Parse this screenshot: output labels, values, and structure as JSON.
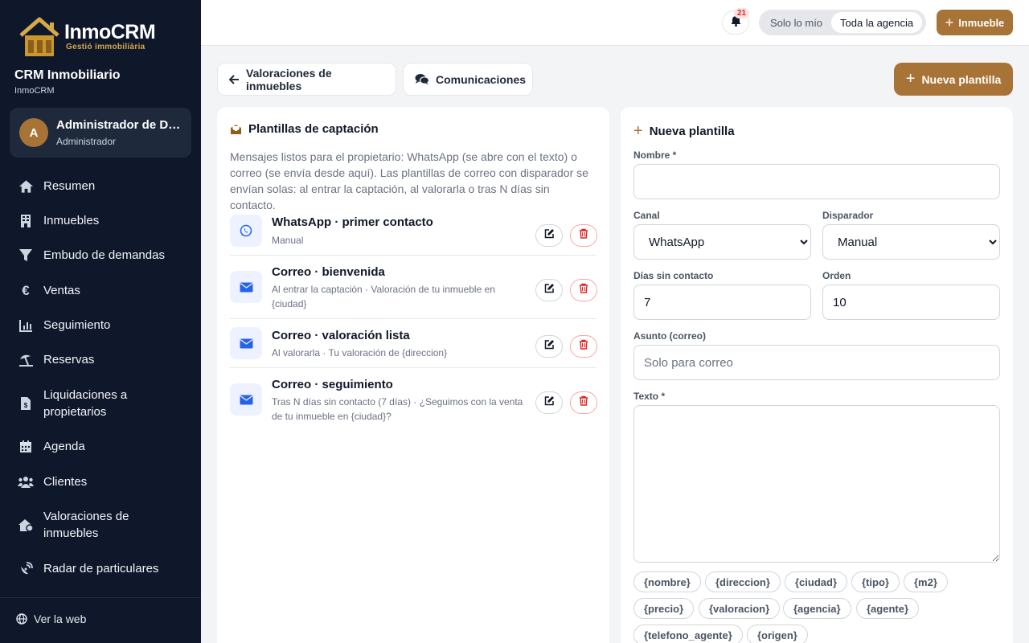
{
  "brand": {
    "name": "InmoCRM",
    "tagline": "Gestió immobiliària",
    "crm_title": "CRM Inmobiliario",
    "crm_subtitle": "InmoCRM"
  },
  "user": {
    "initial": "A",
    "name": "Administrador de De...",
    "role": "Administrador"
  },
  "sidebar": {
    "items": [
      {
        "label": "Resumen",
        "icon": "home-icon"
      },
      {
        "label": "Inmuebles",
        "icon": "building-icon"
      },
      {
        "label": "Embudo de demandas",
        "icon": "funnel-icon"
      },
      {
        "label": "Ventas",
        "icon": "euro-icon"
      },
      {
        "label": "Seguimiento",
        "icon": "bar-chart-icon"
      },
      {
        "label": "Reservas",
        "icon": "umbrella-beach-icon"
      },
      {
        "label": "Liquidaciones a propietarios",
        "icon": "invoice-icon"
      },
      {
        "label": "Agenda",
        "icon": "calendar-icon"
      },
      {
        "label": "Clientes",
        "icon": "users-icon"
      },
      {
        "label": "Valoraciones de inmuebles",
        "icon": "house-value-icon"
      },
      {
        "label": "Radar de particulares",
        "icon": "satellite-icon"
      }
    ],
    "footer_link": "Ver la web"
  },
  "topbar": {
    "notifications": "21",
    "scope_options": [
      "Solo lo mío",
      "Toda la agencia"
    ],
    "scope_selected": "Toda la agencia",
    "new_property_label": "Inmueble"
  },
  "toolbar": {
    "back_label": "Valoraciones de inmuebles",
    "communications_label": "Comunicaciones",
    "new_template_label": "Nueva plantilla"
  },
  "templates_panel": {
    "title": "Plantillas de captación",
    "description": "Mensajes listos para el propietario: WhatsApp (se abre con el texto) o correo (se envía desde aquí). Las plantillas de correo con disparador se envían solas: al entrar la captación, al valorarla o tras N días sin contacto.",
    "items": [
      {
        "name": "WhatsApp · primer contacto",
        "meta": "Manual",
        "icon": "whatsapp-icon"
      },
      {
        "name": "Correo · bienvenida",
        "meta": "Al entrar la captación · Valoración de tu inmueble en {ciudad}",
        "icon": "mail-icon"
      },
      {
        "name": "Correo · valoración lista",
        "meta": "Al valorarla · Tu valoración de {direccion}",
        "icon": "mail-icon"
      },
      {
        "name": "Correo · seguimiento",
        "meta": "Tras N días sin contacto (7 días) · ¿Seguimos con la venta de tu inmueble en {ciudad}?",
        "icon": "mail-icon"
      }
    ]
  },
  "form": {
    "title": "Nueva plantilla",
    "name_label": "Nombre *",
    "name_value": "",
    "channel_label": "Canal",
    "channel_value": "WhatsApp",
    "trigger_label": "Disparador",
    "trigger_value": "Manual",
    "days_label": "Días sin contacto",
    "days_value": "7",
    "order_label": "Orden",
    "order_value": "10",
    "subject_label": "Asunto (correo)",
    "subject_placeholder": "Solo para correo",
    "text_label": "Texto *",
    "text_value": "",
    "variables": [
      "{nombre}",
      "{direccion}",
      "{ciudad}",
      "{tipo}",
      "{m2}",
      "{precio}",
      "{valoracion}",
      "{agencia}",
      "{agente}",
      "{telefono_agente}",
      "{origen}"
    ]
  },
  "colors": {
    "sidebar_bg": "#0f172a",
    "accent": "#a87336",
    "danger": "#dc2626",
    "icon_blue": "#2563eb"
  }
}
